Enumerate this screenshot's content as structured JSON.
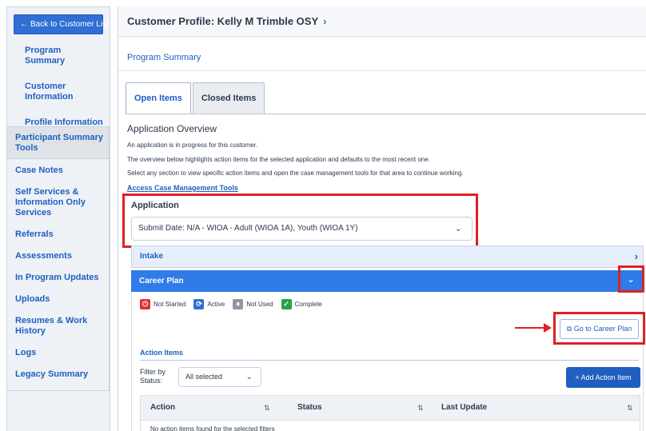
{
  "sidebar": {
    "back_label": "Back to Customer List",
    "items": [
      "Program Summary",
      "Customer Information",
      "Profile Information"
    ],
    "group_header": "Participant Summary Tools",
    "group_items": [
      "Case Notes",
      "Self Services & Information Only Services",
      "Referrals",
      "Assessments",
      "In Program Updates",
      "Uploads",
      "Resumes & Work History",
      "Logs",
      "Legacy Summary"
    ]
  },
  "header": {
    "title": "Customer Profile: Kelly M Trimble OSY"
  },
  "breadcrumb": "Program Summary",
  "tabs": [
    {
      "label": "Open Items",
      "active": true
    },
    {
      "label": "Closed Items",
      "active": false
    }
  ],
  "overview": {
    "title": "Application Overview",
    "lines": [
      "An application is in progress for this customer.",
      "The overview below highlights action items for the selected application and defaults to the most recent one.",
      "Select any section to view specific action items and open the case management tools for that area to continue working."
    ],
    "link": "Access Case Management Tools"
  },
  "application": {
    "label": "Application",
    "selected": "Submit Date: N/A - WIOA - Adult (WIOA 1A), Youth (WIOA 1Y)"
  },
  "sections": {
    "intake": "Intake",
    "career_plan": "Career Plan"
  },
  "legend": [
    "Not Started",
    "Active",
    "Not Used",
    "Complete"
  ],
  "go_button": "Go to Career Plan",
  "action_items": {
    "title": "Action Items",
    "filter_label": "Filter by Status:",
    "filter_value": "All selected",
    "add_button": "Add Action Item",
    "columns": [
      "Action",
      "Status",
      "Last Update"
    ],
    "empty": "No action items found for the selected filters"
  },
  "colors": {
    "accent": "#2f6fd6",
    "highlight": "#e02020"
  }
}
